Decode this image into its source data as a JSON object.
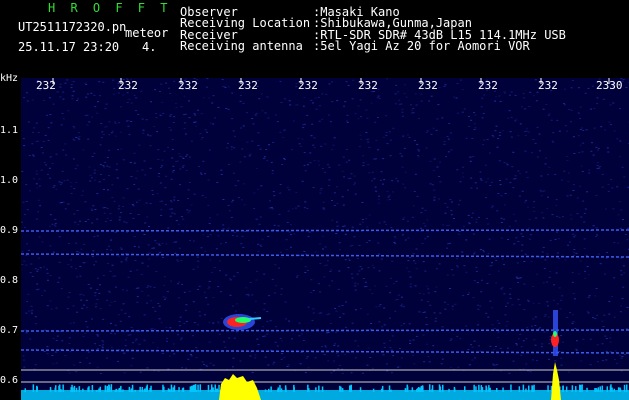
{
  "header": {
    "app_name": "H R O F F T",
    "file_name": "UT2511172320.pn",
    "file_tag": "meteor",
    "datetime": "25.11.17 23:20",
    "count": "4.",
    "fields": [
      {
        "label": "Observer",
        "value": ":Masaki Kano"
      },
      {
        "label": "Receiving Location",
        "value": ":Shibukawa,Gunma,Japan"
      },
      {
        "label": "Receiver",
        "value": ":RTL-SDR SDR# 43dB L15 114.1MHz USB"
      },
      {
        "label": "Receiving antenna",
        "value": ":5el Yagi Az 20 for Aomori VOR"
      }
    ]
  },
  "spectrogram": {
    "y_unit": "kHz",
    "y_ticks": [
      "1.1",
      "1.0",
      "0.9",
      "0.8",
      "0.7",
      "0.6"
    ],
    "x_ticks": [
      "232",
      "232",
      "232",
      "232",
      "232",
      "232",
      "232",
      "232",
      "232",
      "2330"
    ],
    "colors": {
      "background": "#00003a",
      "noise": "#2233aa",
      "signal_line": "#4466ff",
      "grid": "#cfcfcf",
      "meteor": "#ff2222",
      "meteor_core": "#22ff66",
      "level": "#ffff00",
      "baseline": "#00c8ff"
    }
  }
}
